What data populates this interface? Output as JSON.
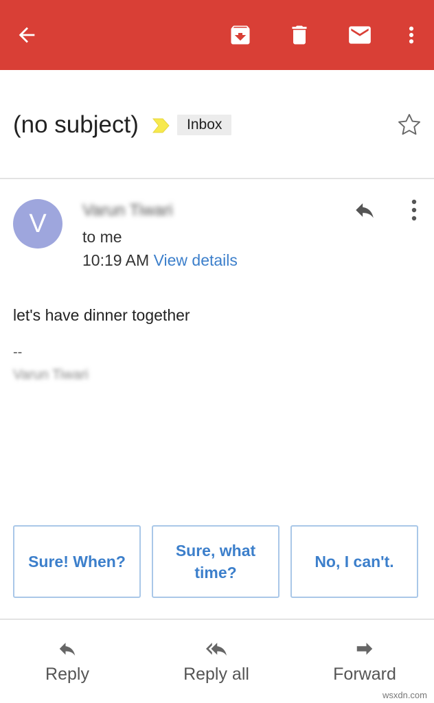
{
  "colors": {
    "appbar": "#d93f36",
    "accent": "#3c7fcb",
    "avatar": "#9ea6dd",
    "importance": "#f7e94d"
  },
  "toolbar": {
    "icons": [
      "back-arrow-icon",
      "archive-icon",
      "delete-icon",
      "mark-unread-icon",
      "more-options-icon"
    ]
  },
  "email": {
    "subject": "(no subject)",
    "label": "Inbox",
    "avatar_letter": "V",
    "sender": "Varun Tiwari",
    "recipient": "to me",
    "time": "10:19 AM",
    "view_details": "View details",
    "body": "let's have dinner together",
    "signature_dash": "--",
    "signature_name": "Varun Tiwari"
  },
  "smart_replies": [
    "Sure! When?",
    "Sure, what time?",
    "No, I can't."
  ],
  "actions": {
    "reply": "Reply",
    "reply_all": "Reply all",
    "forward": "Forward"
  },
  "watermark": "wsxdn.com"
}
